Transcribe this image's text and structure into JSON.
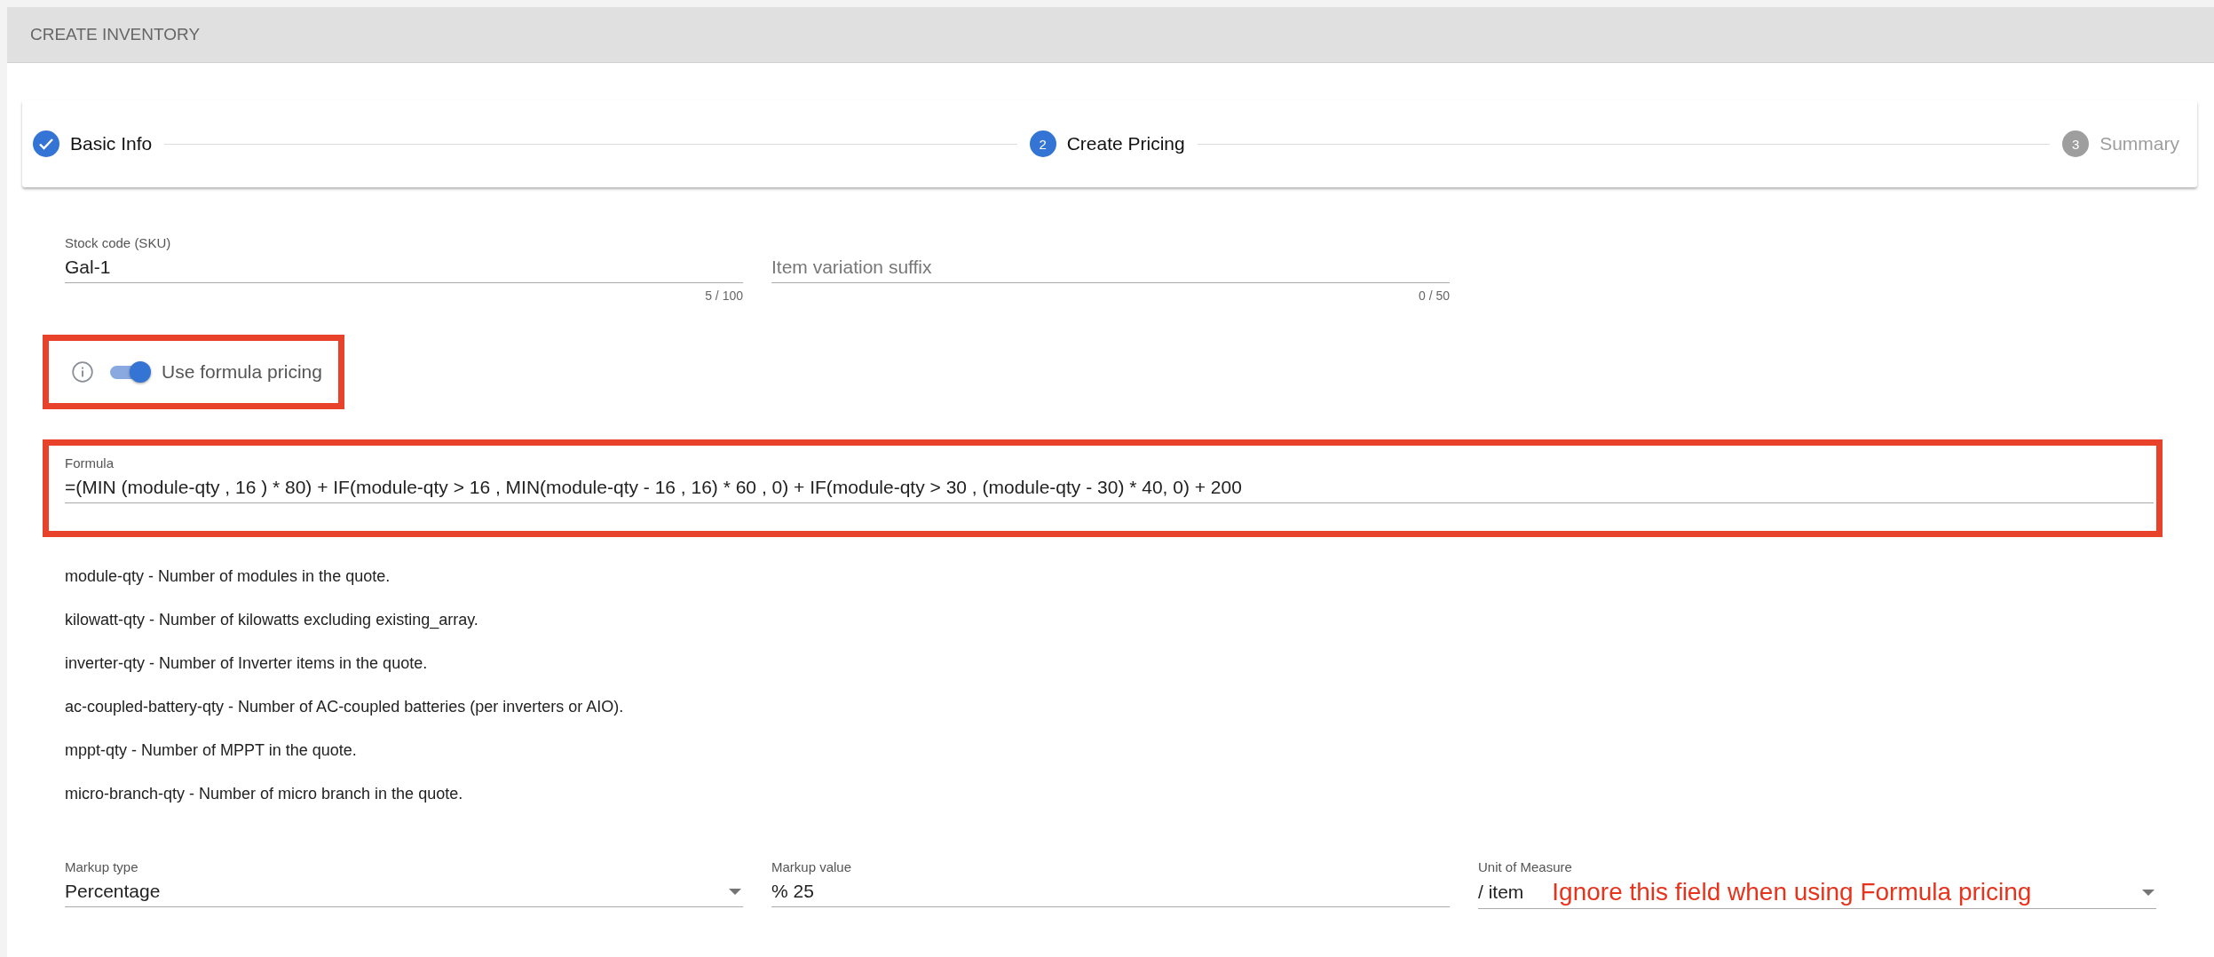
{
  "page_title": "CREATE INVENTORY",
  "steps": [
    {
      "label": "Basic Info",
      "kind": "done"
    },
    {
      "label": "Create Pricing",
      "kind": "active",
      "number": "2"
    },
    {
      "label": "Summary",
      "kind": "pending",
      "number": "3"
    }
  ],
  "fields_top": [
    {
      "label": "Stock code (SKU)",
      "value": "Gal-1",
      "counter": "5 / 100"
    },
    {
      "placeholder": "Item variation suffix",
      "counter": "0 / 50"
    }
  ],
  "formula_toggle": {
    "label": "Use formula pricing",
    "on": true,
    "highlighted": true
  },
  "formula_field": {
    "label": "Formula",
    "value": "=(MIN (module-qty , 16 ) * 80) + IF(module-qty > 16 , MIN(module-qty - 16 , 16) * 60 , 0) + IF(module-qty > 30 , (module-qty - 30) * 40, 0) + 200",
    "highlighted": true
  },
  "variables": [
    "module-qty - Number of modules in the quote.",
    "kilowatt-qty - Number of kilowatts excluding existing_array.",
    "inverter-qty - Number of Inverter items in the quote.",
    "ac-coupled-battery-qty - Number of AC-coupled batteries (per inverters or AIO).",
    "mppt-qty - Number of MPPT in the quote.",
    "micro-branch-qty - Number of micro branch in the quote."
  ],
  "fields_bottom": [
    {
      "label": "Markup type",
      "value": "Percentage",
      "kind": "select"
    },
    {
      "label": "Markup value",
      "value": "% 25",
      "kind": "text"
    },
    {
      "label": "Unit of Measure",
      "value": "/ item",
      "kind": "select",
      "annotation": "Ignore this field when using Formula pricing"
    }
  ]
}
